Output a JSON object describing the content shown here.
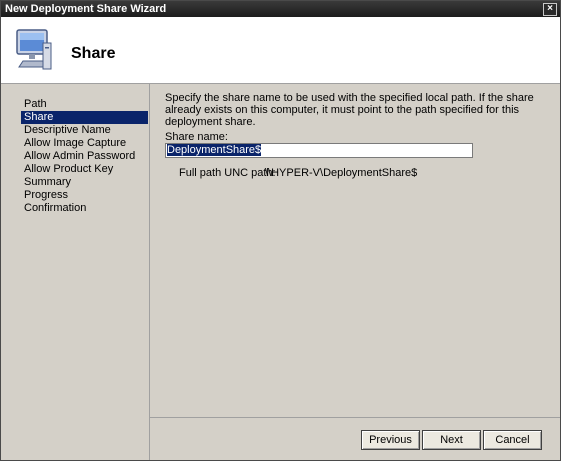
{
  "window": {
    "title": "New Deployment Share Wizard",
    "close_glyph": "×"
  },
  "header": {
    "icon": "computer-monitor-icon",
    "title": "Share"
  },
  "sidebar": {
    "items": [
      {
        "label": "Path",
        "active": false
      },
      {
        "label": "Share",
        "active": true
      },
      {
        "label": "Descriptive Name",
        "active": false
      },
      {
        "label": "Allow Image Capture",
        "active": false
      },
      {
        "label": "Allow Admin Password",
        "active": false
      },
      {
        "label": "Allow Product Key",
        "active": false
      },
      {
        "label": "Summary",
        "active": false
      },
      {
        "label": "Progress",
        "active": false
      },
      {
        "label": "Confirmation",
        "active": false
      }
    ]
  },
  "main": {
    "description": "Specify the share name to be used with the specified local path.  If the share already exists on this computer, it must point to the path specified for this deployment share.",
    "share_name_label": "Share name:",
    "share_name_value": "DeploymentShare$",
    "unc_label": "Full path UNC path:",
    "unc_value": "\\\\HYPER-V\\DeploymentShare$"
  },
  "buttons": {
    "previous": "Previous",
    "next": "Next",
    "cancel": "Cancel"
  },
  "colors": {
    "selection": "#0a246a",
    "titlebar": "#2a2a2a",
    "panel": "#d4d0c8"
  }
}
